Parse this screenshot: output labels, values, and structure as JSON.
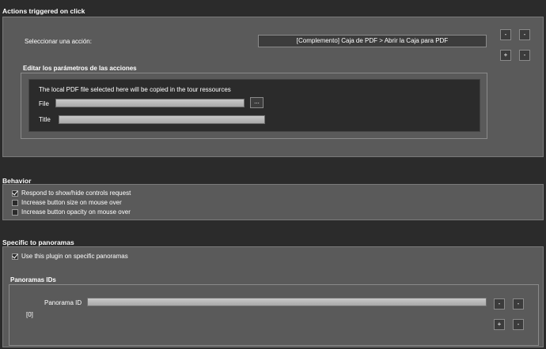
{
  "actions": {
    "title": "Actions triggered on click",
    "select_label": "Seleccionar una acción:",
    "selected_action": "[Complemento] Caja de PDF > Abrir la Caja para PDF",
    "buttons": {
      "remove": "-",
      "move_up": "-",
      "add": "+",
      "move_down": "-"
    },
    "params": {
      "title": "Editar los parámetros de las acciones",
      "info": "The local PDF file selected here will be copied in the tour ressources",
      "file_label": "File",
      "file_value": "",
      "browse_label": "...",
      "title_label": "Title",
      "title_value": ""
    }
  },
  "behavior": {
    "title": "Behavior",
    "options": [
      {
        "label": "Respond to show/hide controls request",
        "checked": true
      },
      {
        "label": "Increase button size on mouse over",
        "checked": false
      },
      {
        "label": "Increase button opacity on mouse over",
        "checked": false
      }
    ]
  },
  "specific": {
    "title": "Specific to panoramas",
    "use_label": "Use this plugin on specific panoramas",
    "use_checked": true,
    "ids_title": "Panoramas IDs",
    "panorama_id_label": "Panorama ID",
    "panorama_id_value": "",
    "index_label": "[0]",
    "buttons": {
      "remove": "-",
      "move_up": "-",
      "add": "+",
      "move_down": "-"
    }
  },
  "colors": {
    "background": "#2b2b2b",
    "panel": "#5a5a5a",
    "field": "#b8b8b8"
  }
}
